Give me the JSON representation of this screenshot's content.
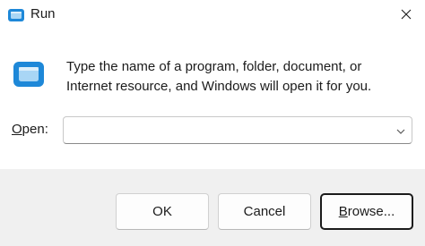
{
  "window": {
    "title": "Run",
    "app_icon": "run-app-icon",
    "close_icon": "close-icon"
  },
  "message": {
    "line1": "Type the name of a program, folder, document, or",
    "line2": "Internet resource, and Windows will open it for you.",
    "icon": "run-app-icon"
  },
  "open_field": {
    "label_access_key": "O",
    "label_rest": "pen:",
    "value": "",
    "dropdown_icon": "chevron-down-icon"
  },
  "buttons": {
    "ok": "OK",
    "cancel": "Cancel",
    "browse_access_key": "B",
    "browse_rest": "rowse..."
  },
  "colors": {
    "icon_blue": "#1e88d8",
    "icon_light": "#a9d6f5",
    "footer_bg": "#f0f0f0",
    "content_bg": "#ffffff"
  }
}
